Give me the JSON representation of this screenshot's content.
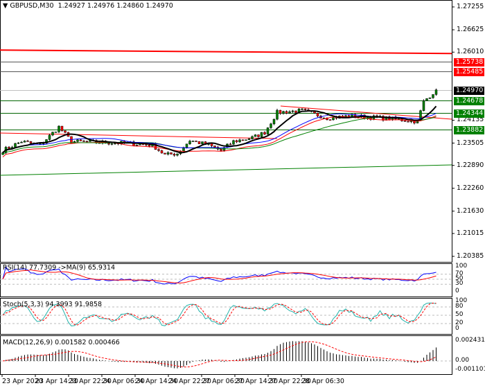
{
  "header": {
    "symbol": "GBPUSD,M30",
    "ohlc": "1.24927 1.24976 1.24860 1.24970"
  },
  "price_axis": [
    "1.27255",
    "1.26625",
    "1.26010",
    "1.24135",
    "1.23505",
    "1.22890",
    "1.22260",
    "1.21630",
    "1.21015",
    "1.20385"
  ],
  "price_range": [
    1.20385,
    1.27255
  ],
  "levels": [
    {
      "label": "1.25738",
      "price": 1.25738,
      "bg": "#ff0000",
      "line": "#555555"
    },
    {
      "label": "1.25485",
      "price": 1.25485,
      "bg": "#ff0000",
      "line": "#555555"
    },
    {
      "label": "1.24970",
      "price": 1.2497,
      "bg": "#000000",
      "line": "#c0c0c0"
    },
    {
      "label": "1.24678",
      "price": 1.24678,
      "bg": "#008000",
      "line": "#006400"
    },
    {
      "label": "1.24344",
      "price": 1.24344,
      "bg": "#008000",
      "line": "#006400"
    },
    {
      "label": "1.23882",
      "price": 1.23882,
      "bg": "#008000",
      "line": "#006400"
    }
  ],
  "resistance_line": {
    "price": 1.2601,
    "color": "#ff0000"
  },
  "price_path": [
    [
      0,
      1.233
    ],
    [
      6,
      1.2355
    ],
    [
      12,
      1.2345
    ],
    [
      18,
      1.2395
    ],
    [
      22,
      1.2355
    ],
    [
      40,
      1.235
    ],
    [
      48,
      1.2345
    ],
    [
      52,
      1.2318
    ],
    [
      56,
      1.2322
    ],
    [
      60,
      1.2358
    ],
    [
      66,
      1.2345
    ],
    [
      70,
      1.233
    ],
    [
      74,
      1.2355
    ],
    [
      80,
      1.2365
    ],
    [
      84,
      1.238
    ],
    [
      88,
      1.2435
    ],
    [
      96,
      1.244
    ],
    [
      104,
      1.242
    ],
    [
      112,
      1.2425
    ],
    [
      124,
      1.2418
    ],
    [
      133,
      1.241
    ],
    [
      135,
      1.2465
    ],
    [
      139,
      1.2497
    ]
  ],
  "rsi": {
    "label": "RSI(14) 77.7309  ->MA(9) 65.9314",
    "axis": [
      "100",
      "70",
      "50",
      "30",
      "0"
    ]
  },
  "stoch": {
    "label": "Stoch(5,3,3) 94.3993 91.9858",
    "axis": [
      "100",
      "80",
      "50",
      "20",
      "0"
    ]
  },
  "macd": {
    "label": "MACD(12,26,9) 0.001582 0.000466",
    "axis": [
      "0.002431",
      "0.00",
      "-0.001101"
    ]
  },
  "time_axis": [
    "23 Apr 2020",
    "23 Apr 14:30",
    "23 Apr 22:30",
    "24 Apr 06:30",
    "24 Apr 14:30",
    "24 Apr 22:30",
    "27 Apr 06:30",
    "27 Apr 14:30",
    "27 Apr 22:30",
    "28 Apr 06:30"
  ],
  "colors": {
    "bull": "#008000",
    "bear": "#ff0000",
    "ma_fast": "#000000",
    "ma_mid": "#0000ff",
    "ma_slow": "#008000",
    "ma_long": "#ff0000",
    "stoch_main": "#20b2aa",
    "macd_signal": "#ff0000"
  }
}
